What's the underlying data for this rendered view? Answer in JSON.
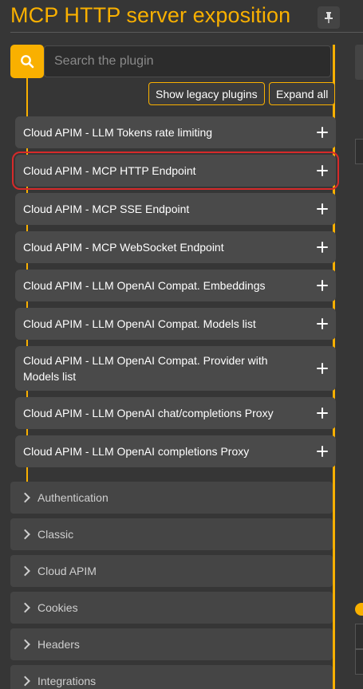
{
  "header": {
    "title": "MCP HTTP server exposition",
    "pin_icon": "pin-icon"
  },
  "search": {
    "icon": "search-icon",
    "placeholder": "Search the plugin",
    "value": ""
  },
  "actions": {
    "legacy_label": "Show legacy plugins",
    "expand_label": "Expand all"
  },
  "plugins": [
    {
      "label": "Cloud APIM - LLM Tokens rate limiting"
    },
    {
      "label": "Cloud APIM - MCP HTTP Endpoint",
      "highlighted": true
    },
    {
      "label": "Cloud APIM - MCP SSE Endpoint"
    },
    {
      "label": "Cloud APIM - MCP WebSocket Endpoint"
    },
    {
      "label": "Cloud APIM - LLM OpenAI Compat. Embeddings"
    },
    {
      "label": "Cloud APIM - LLM OpenAI Compat. Models list"
    },
    {
      "label": "Cloud APIM - LLM OpenAI Compat. Provider with Models list"
    },
    {
      "label": "Cloud APIM - LLM OpenAI chat/completions Proxy"
    },
    {
      "label": "Cloud APIM - LLM OpenAI completions Proxy"
    }
  ],
  "categories": [
    {
      "label": "Authentication"
    },
    {
      "label": "Classic"
    },
    {
      "label": "Cloud APIM"
    },
    {
      "label": "Cookies"
    },
    {
      "label": "Headers"
    },
    {
      "label": "Integrations"
    }
  ],
  "colors": {
    "accent": "#f9b000",
    "highlight": "#d62a2a",
    "background": "#363636",
    "item_bg": "#4a4a4a"
  }
}
